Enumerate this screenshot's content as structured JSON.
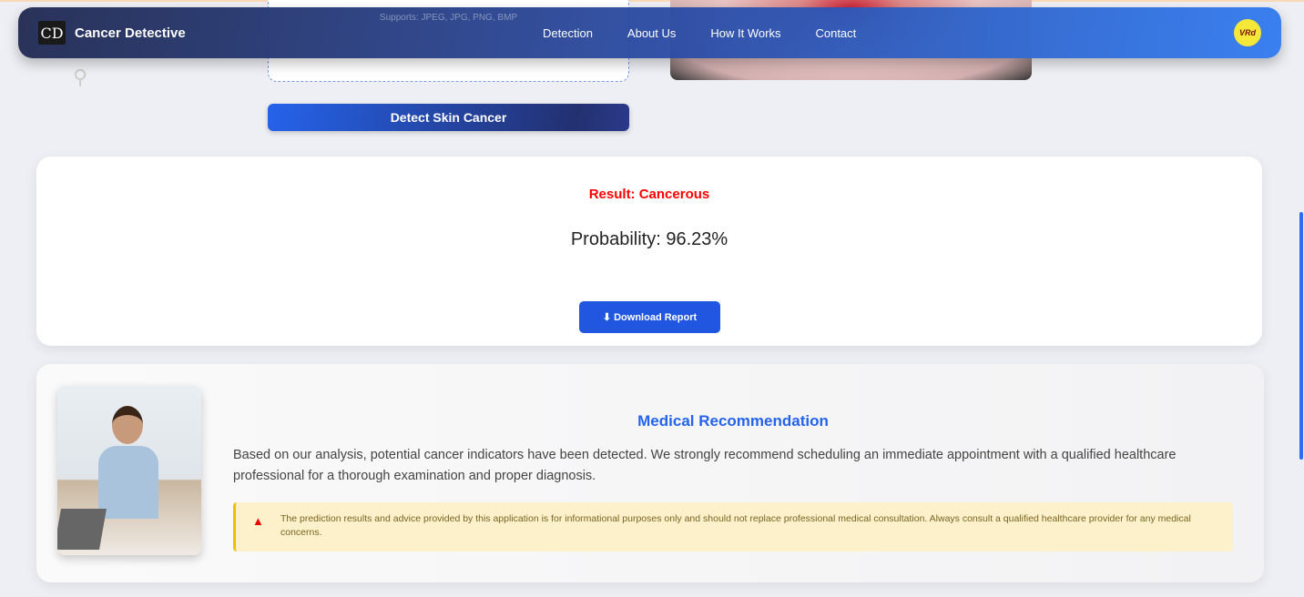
{
  "upload": {
    "supports": "Supports: JPEG, JPG, PNG, BMP"
  },
  "detect_button": "Detect Skin Cancer",
  "nav": {
    "logo": "CD",
    "brand": "Cancer Detective",
    "links": [
      "Detection",
      "About Us",
      "How It Works",
      "Contact"
    ],
    "avatar": "VRd"
  },
  "result": {
    "title": "Result: Cancerous",
    "probability": "Probability: 96.23%",
    "download": "Download Report"
  },
  "recommendation": {
    "heading": "Medical Recommendation",
    "text": "Based on our analysis, potential cancer indicators have been detected. We strongly recommend scheduling an immediate appointment with a qualified healthcare professional for a thorough examination and proper diagnosis.",
    "warning": "The prediction results and advice provided by this application is for informational purposes only and should not replace professional medical consultation. Always consult a qualified healthcare provider for any medical concerns."
  }
}
